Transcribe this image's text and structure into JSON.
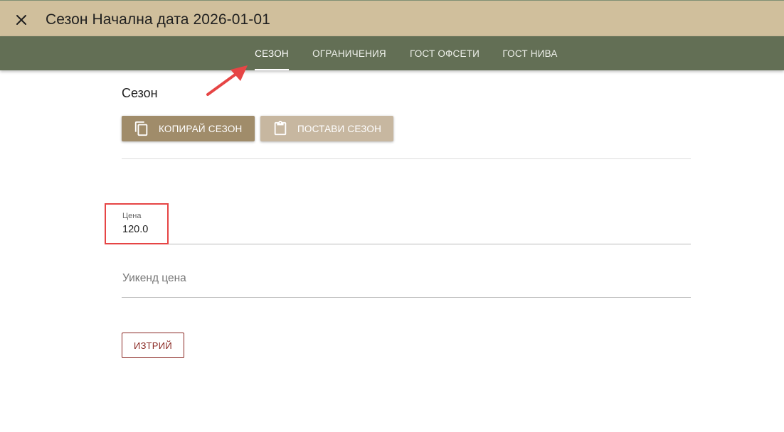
{
  "header": {
    "title": "Сезон Начална дата 2026-01-01",
    "close_icon": "close-icon"
  },
  "tabs": [
    {
      "label": "СЕЗОН",
      "active": true
    },
    {
      "label": "ОГРАНИЧЕНИЯ",
      "active": false
    },
    {
      "label": "ГОСТ ОФСЕТИ",
      "active": false
    },
    {
      "label": "ГОСТ НИВА",
      "active": false
    }
  ],
  "section": {
    "title": "Сезон",
    "copy_button": {
      "label": "КОПИРАЙ СЕЗОН",
      "icon": "copy-icon"
    },
    "paste_button": {
      "label": "ПОСТАВИ СЕЗОН",
      "icon": "clipboard-icon"
    }
  },
  "fields": {
    "price": {
      "label": "Цена",
      "value": "120.0"
    },
    "weekend_price": {
      "placeholder": "Уикенд цена",
      "value": ""
    }
  },
  "actions": {
    "delete_label": "ИЗТРИЙ"
  },
  "colors": {
    "titlebar": "#d0bf9c",
    "tabbar": "#636f55",
    "copy_button": "#a08c6a",
    "paste_button": "#c7b7a0",
    "delete": "#8b2a25",
    "annotation": "#e64545"
  }
}
